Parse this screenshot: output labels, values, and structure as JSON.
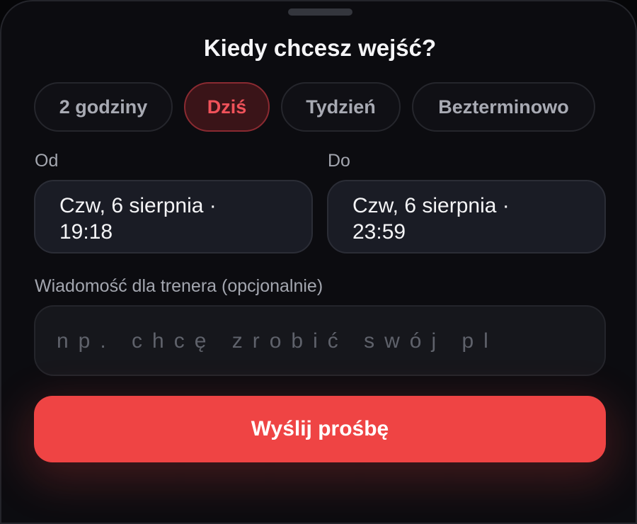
{
  "sheet": {
    "title": "Kiedy chcesz wejść?"
  },
  "durations": {
    "options": [
      {
        "label": "2 godziny",
        "selected": false
      },
      {
        "label": "Dziś",
        "selected": true
      },
      {
        "label": "Tydzień",
        "selected": false
      },
      {
        "label": "Bezterminowo",
        "selected": false
      }
    ]
  },
  "range": {
    "from": {
      "label": "Od",
      "value_line1": "Czw, 6 sierpnia ·",
      "value_line2": "19:18"
    },
    "to": {
      "label": "Do",
      "value_line1": "Czw, 6 sierpnia ·",
      "value_line2": "23:59"
    }
  },
  "message": {
    "label": "Wiadomość dla trenera (opcjonalnie)",
    "value": "",
    "placeholder": "np. chcę zrobić swój pl"
  },
  "submit": {
    "label": "Wyślij prośbę"
  },
  "colors": {
    "accent": "#ef4444",
    "selected_chip_bg": "#3a1418",
    "selected_chip_text": "#f0525a",
    "background": "#0c0c10"
  }
}
